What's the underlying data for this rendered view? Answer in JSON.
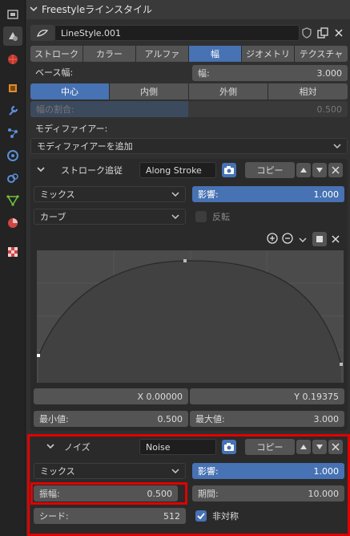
{
  "panel": {
    "title": "Freestyleラインスタイル",
    "linestyle_name": "LineStyle.001"
  },
  "tabs": [
    "ストローク",
    "カラー",
    "アルファ",
    "幅",
    "ジオメトリ",
    "テクスチャ"
  ],
  "base_width": {
    "label": "ベース幅:",
    "field_label": "幅:",
    "value": "3.000"
  },
  "alignment": [
    "中心",
    "内側",
    "外側",
    "相対"
  ],
  "width_ratio": {
    "label": "幅の割合:",
    "value": "0.500"
  },
  "modifiers": {
    "label": "モディファイアー:",
    "add_label": "モディファイアーを追加"
  },
  "along_stroke": {
    "type_label": "ストローク追従",
    "name": "Along Stroke",
    "copy_label": "コピー",
    "blend": "ミックス",
    "influence_label": "影響:",
    "influence_value": "1.000",
    "mapping": "カーブ",
    "invert_label": "反転",
    "curve_x_label": "X",
    "curve_x": "0.00000",
    "curve_y_label": "Y",
    "curve_y": "0.19375",
    "min_label": "最小値:",
    "min_value": "0.500",
    "max_label": "最大値:",
    "max_value": "3.000"
  },
  "noise": {
    "type_label": "ノイズ",
    "name": "Noise",
    "copy_label": "コピー",
    "blend": "ミックス",
    "influence_label": "影響:",
    "influence_value": "1.000",
    "amplitude_label": "振幅:",
    "amplitude_value": "0.500",
    "period_label": "期間:",
    "period_value": "10.000",
    "seed_label": "シード:",
    "seed_value": "512",
    "asymmetric_label": "非対称",
    "asymmetric_checked": true
  },
  "colors": {
    "accent": "#4772b3",
    "highlight": "#e00000"
  }
}
